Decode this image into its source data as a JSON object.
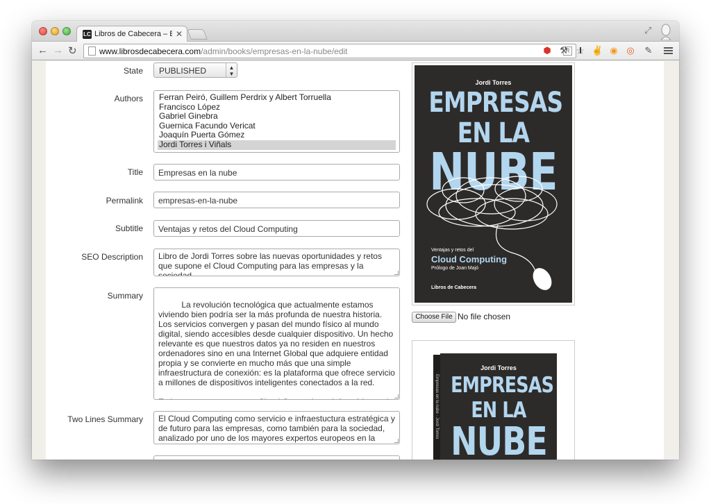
{
  "browser": {
    "tab_title": "Libros de Cabecera – Edito",
    "tab_favicon": "LC",
    "url_host": "www.librosdecabecera.com",
    "url_path": "/admin/books/empresas-en-la-nube/edit"
  },
  "form": {
    "state": {
      "label": "State",
      "value": "PUBLISHED"
    },
    "authors": {
      "label": "Authors",
      "options": [
        "Ferran Peiró, Guillem Perdrix y Albert Torruella",
        "Francisco López",
        "Gabriel Ginebra",
        "Guernica Facundo Vericat",
        "Joaquín Puerta Gómez",
        "Jordi Torres i Viñals"
      ],
      "selected_index": 5
    },
    "title": {
      "label": "Title",
      "value": "Empresas en la nube"
    },
    "permalink": {
      "label": "Permalink",
      "value": "empresas-en-la-nube"
    },
    "subtitle": {
      "label": "Subtitle",
      "value": "Ventajas y retos del Cloud Computing"
    },
    "seo": {
      "label": "SEO Description",
      "value": "Libro de Jordi Torres sobre las nuevas oportunidades y retos que supone el Cloud Computing para las empresas y la sociedad"
    },
    "summary": {
      "label": "Summary",
      "value": "La revolución tecnológica que actualmente estamos viviendo bien podría ser la más profunda de nuestra historia. Los servicios convergen y pasan del mundo físico al mundo digital, siendo accesibles desde cualquier dispositivo. Un hecho relevante es que nuestros datos ya no residen en nuestros ordenadores sino en una Internet Global que adquiere entidad propia y se convierte en mucho más que una simple infraestructura de conexión: es la plataforma que ofrece servicio a millones de dispositivos inteligentes conectados a la red.\n\nEs lo que se conoce como Cloud Computing o informática en la nube de Internet, que permite que los consumidores, empresas y"
    },
    "two_lines": {
      "label": "Two Lines Summary",
      "value": "El Cloud Computing como servicio e infraestuctura estratégica y de futuro para las empresas, como también para la sociedad, analizado por uno de los mayores expertos europeos en la materia"
    }
  },
  "cover": {
    "author": "Jordi Torres",
    "line1": "EMPRESAS",
    "line2": "EN LA",
    "line3": "NUBE",
    "subtitle_small": "Ventajas y retos del",
    "subtitle_big": "Cloud Computing",
    "prologue": "Prólogo de Joan Majó",
    "publisher": "Libros de Cabecera"
  },
  "file_input": {
    "button": "Choose File",
    "status": "No file chosen"
  },
  "cover3d": {
    "author": "Jordi Torres",
    "spine": "Empresas en la nube · Jordi Torres",
    "line1": "EMPRESAS",
    "line2": "EN LA",
    "line3": "NUBE"
  },
  "colors": {
    "cover_bg": "#2d2b29",
    "cover_title": "#b3d6ef"
  }
}
